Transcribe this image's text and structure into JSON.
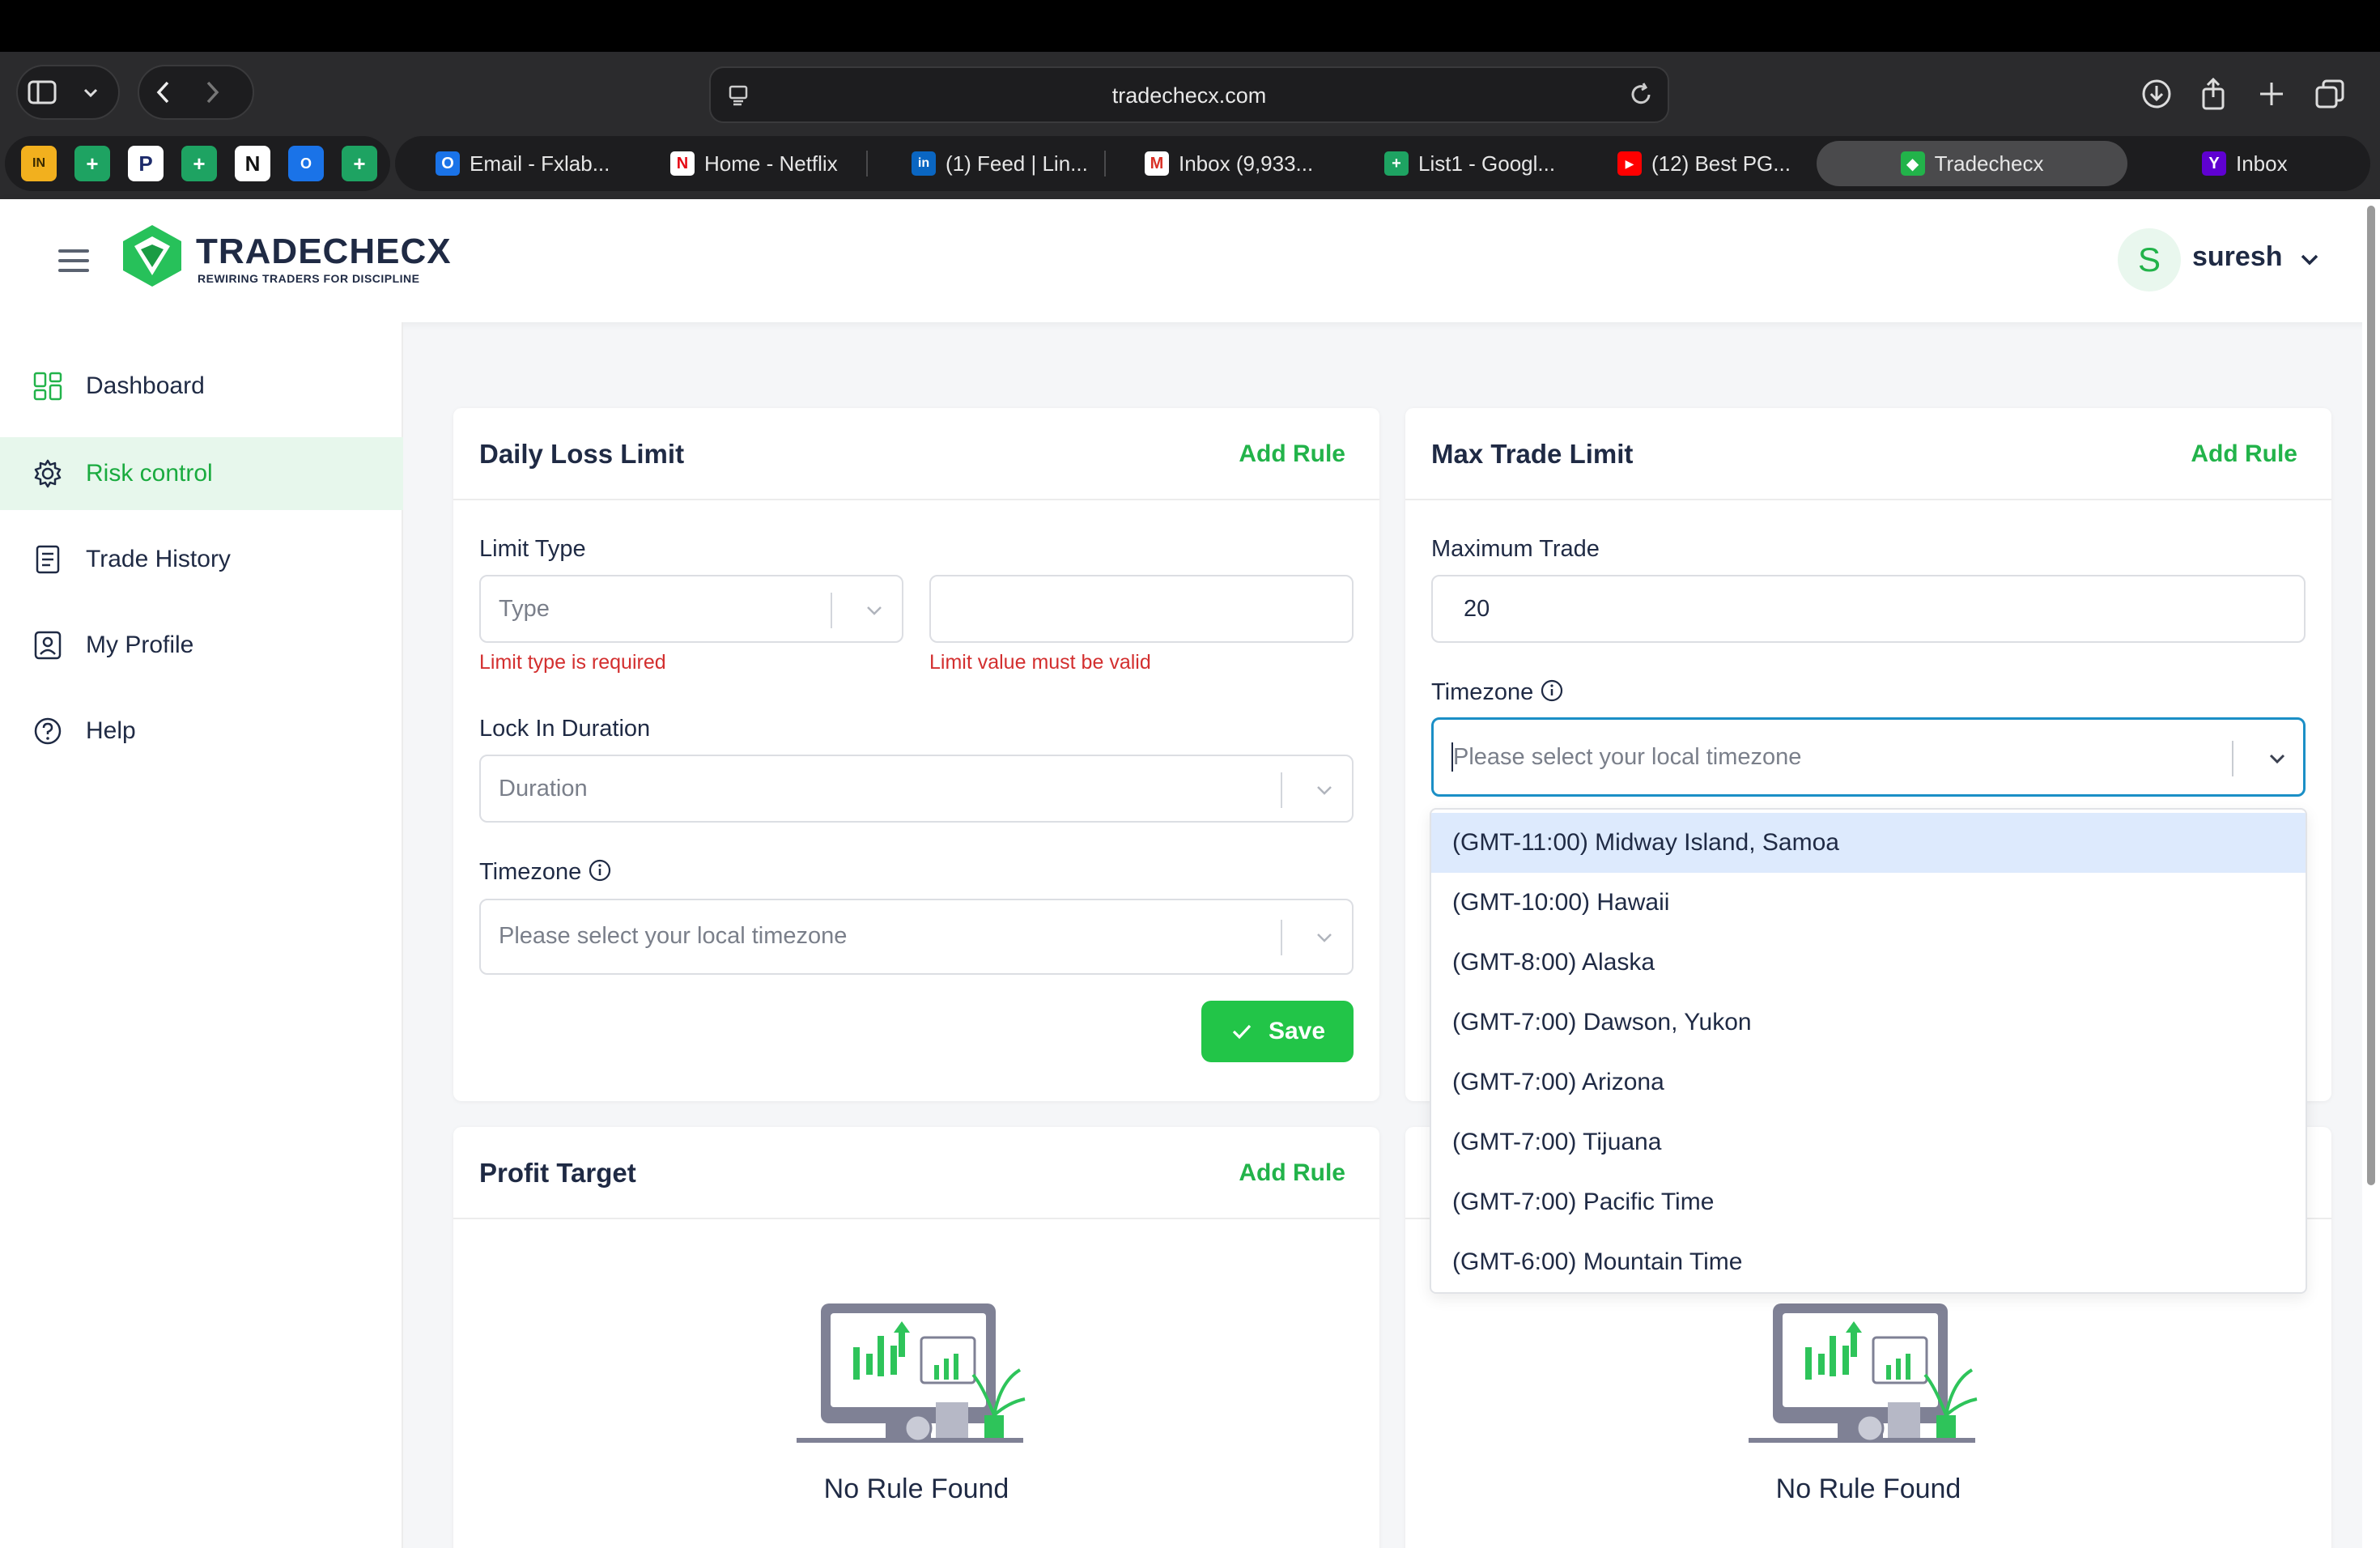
{
  "browser": {
    "url": "tradechecx.com",
    "tabs": [
      {
        "label": "Email - Fxlab...",
        "icon": "outlook-icon"
      },
      {
        "label": "Home - Netflix",
        "icon": "netflix-icon"
      },
      {
        "label": "(1) Feed | Lin...",
        "icon": "linkedin-icon"
      },
      {
        "label": "Inbox (9,933...",
        "icon": "gmail-icon"
      },
      {
        "label": "List1 - Googl...",
        "icon": "sheets-icon"
      },
      {
        "label": "(12) Best PG...",
        "icon": "youtube-icon"
      },
      {
        "label": "Tradechecx",
        "icon": "tradechecx-icon",
        "active": true
      },
      {
        "label": "Inbox",
        "icon": "yahoo-icon"
      }
    ]
  },
  "header": {
    "brand": "TRADECHECX",
    "tagline": "REWIRING TRADERS FOR DISCIPLINE",
    "avatar_letter": "S",
    "username": "suresh"
  },
  "sidebar": {
    "items": [
      {
        "label": "Dashboard"
      },
      {
        "label": "Risk control",
        "active": true
      },
      {
        "label": "Trade History"
      },
      {
        "label": "My Profile"
      },
      {
        "label": "Help"
      }
    ]
  },
  "daily_loss": {
    "title": "Daily Loss Limit",
    "add_rule": "Add Rule",
    "limit_type_label": "Limit Type",
    "type_placeholder": "Type",
    "limit_value": "",
    "error_type": "Limit type is required",
    "error_value": "Limit value must be valid",
    "lock_label": "Lock In Duration",
    "duration_placeholder": "Duration",
    "timezone_label": "Timezone",
    "timezone_placeholder": "Please select your local timezone",
    "save": "Save"
  },
  "max_trade": {
    "title": "Max Trade Limit",
    "add_rule": "Add Rule",
    "max_label": "Maximum Trade",
    "max_value": "20",
    "timezone_label": "Timezone",
    "timezone_placeholder": "Please select your local timezone",
    "options": [
      "(GMT-11:00) Midway Island, Samoa",
      "(GMT-10:00) Hawaii",
      "(GMT-8:00) Alaska",
      "(GMT-7:00) Dawson, Yukon",
      "(GMT-7:00) Arizona",
      "(GMT-7:00) Tijuana",
      "(GMT-7:00) Pacific Time",
      "(GMT-6:00) Mountain Time"
    ]
  },
  "profit_target": {
    "title": "Profit Target",
    "add_rule": "Add Rule",
    "empty": "No Rule Found"
  },
  "fourth_card": {
    "empty": "No Rule Found"
  },
  "colors": {
    "accent_green": "#22b34a",
    "error_red": "#d32f2f",
    "focus_blue": "#1b8fc6",
    "highlight": "#ddeafd"
  }
}
